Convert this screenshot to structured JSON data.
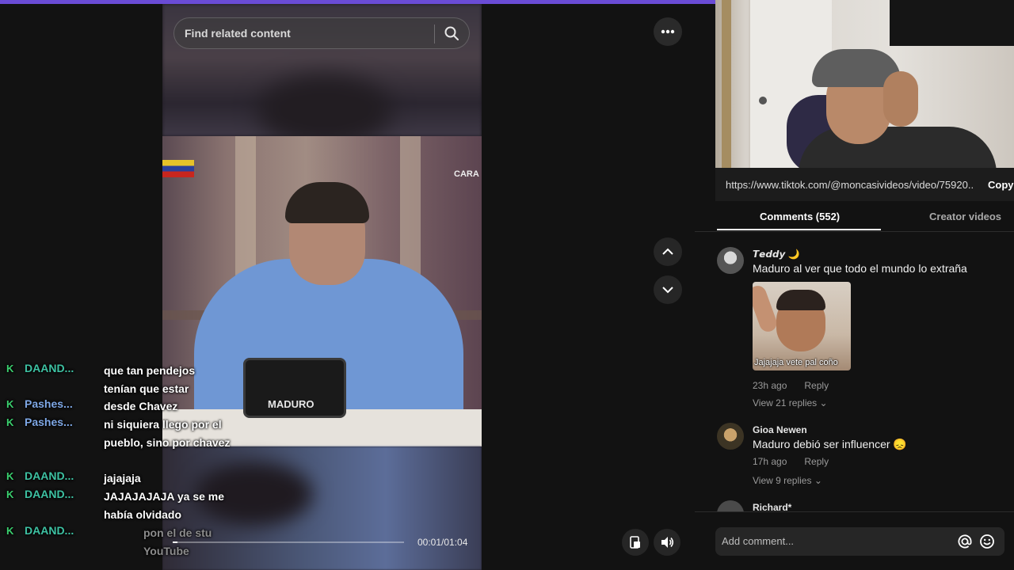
{
  "colors": {
    "top_accent": "#6a4cd6",
    "chat_badge": "#3bd16f",
    "user_teal": "#3ec2a3",
    "user_blue": "#7fa8e6",
    "background": "#121212"
  },
  "video": {
    "search_placeholder": "Find related content",
    "overlay_brand": "CARA",
    "tablet_label": "MADURO",
    "time": "00:01/01:04",
    "progress": 0.02
  },
  "chat": [
    {
      "badge": "K",
      "user": "DAAND...",
      "message": "que tan pendejos tenían que estar",
      "user_color": "#3ec2a3"
    },
    {
      "badge": "K",
      "user": "Pashes...",
      "message": "desde Chavez",
      "user_color": "#7fa8e6"
    },
    {
      "badge": "K",
      "user": "Pashes...",
      "message": "ni siquiera llego por el pueblo, sino por chavez",
      "user_color": "#7fa8e6"
    },
    {
      "badge": "K",
      "user": "DAAND...",
      "message": "jajajaja",
      "user_color": "#3ec2a3"
    },
    {
      "badge": "K",
      "user": "DAAND...",
      "message": "JAJAJAJAJA ya se me había olvidado",
      "user_color": "#3ec2a3"
    },
    {
      "badge": "K",
      "user": "DAAND...",
      "message": "pon el de stu YouTube",
      "user_color": "#3ec2a3"
    }
  ],
  "url_bar": {
    "url": "https://www.tiktok.com/@moncasivideos/video/75920...",
    "copy_label": "Copy"
  },
  "tabs": {
    "comments": "Comments (552)",
    "creator": "Creator videos"
  },
  "comments": [
    {
      "user": "𝙏𝙚𝙙𝙙𝙮 🌙",
      "text": "Maduro al ver que todo el mundo lo extraña",
      "sticker_caption": "Jajajaja vete pal coño",
      "time": "23h ago",
      "reply": "Reply",
      "views": "View 21 replies ⌄"
    },
    {
      "user": "Gioa Newen",
      "text": "Maduro debió ser influencer 😞",
      "time": "17h ago",
      "reply": "Reply",
      "views": "View 9 replies ⌄"
    },
    {
      "user": "Richard*"
    }
  ],
  "comment_input": {
    "placeholder": "Add comment..."
  },
  "icons": [
    "search-icon",
    "more-icon",
    "chevron-up-icon",
    "chevron-down-icon",
    "pip-icon",
    "volume-icon",
    "at-icon",
    "emoji-icon"
  ]
}
